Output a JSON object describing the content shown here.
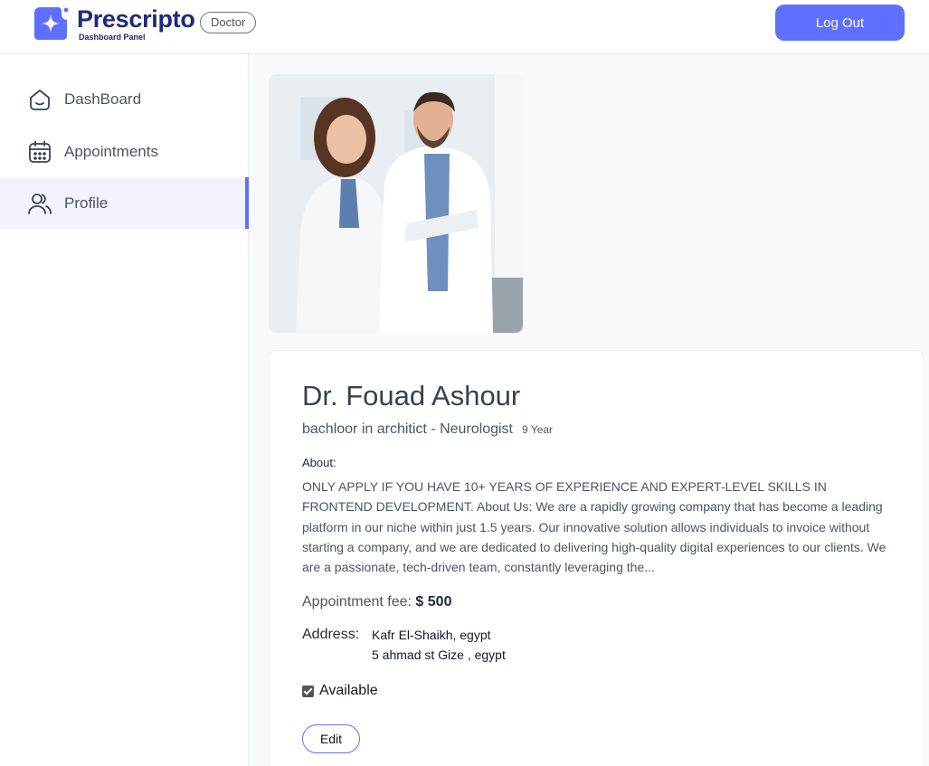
{
  "brand": {
    "name": "Prescripto",
    "subtitle": "Dashboard Panel",
    "role_badge": "Doctor"
  },
  "header": {
    "logout_label": "Log Out"
  },
  "sidebar": {
    "items": [
      {
        "label": "DashBoard",
        "icon": "home-icon",
        "active": false
      },
      {
        "label": "Appointments",
        "icon": "calendar-icon",
        "active": false
      },
      {
        "label": "Profile",
        "icon": "users-icon",
        "active": true
      }
    ]
  },
  "profile": {
    "name": "Dr. Fouad Ashour",
    "degree_speciality": "bachloor in architict - Neurologist",
    "experience": "9 Year",
    "about_label": "About:",
    "about_text": "ONLY APPLY IF YOU HAVE 10+ YEARS OF EXPERIENCE AND EXPERT-LEVEL SKILLS IN FRONTEND DEVELOPMENT. About Us: We are a rapidly growing company that has become a leading platform in our niche within just 1.5 years. Our innovative solution allows individuals to invoice without starting a company, and we are dedicated to delivering high-quality digital experiences to our clients. We are a passionate, tech-driven team, constantly leveraging the...",
    "fee_label": "Appointment fee:",
    "fee_value": "$ 500",
    "address_label": "Address:",
    "address_line1": "Kafr El-Shaikh, egypt",
    "address_line2": "5 ahmad st Gize , egypt",
    "available_label": "Available",
    "available": true,
    "edit_label": "Edit"
  },
  "colors": {
    "accent": "#5f6fff",
    "brand": "#1e2a78",
    "active_bg": "#f2f3ff"
  }
}
